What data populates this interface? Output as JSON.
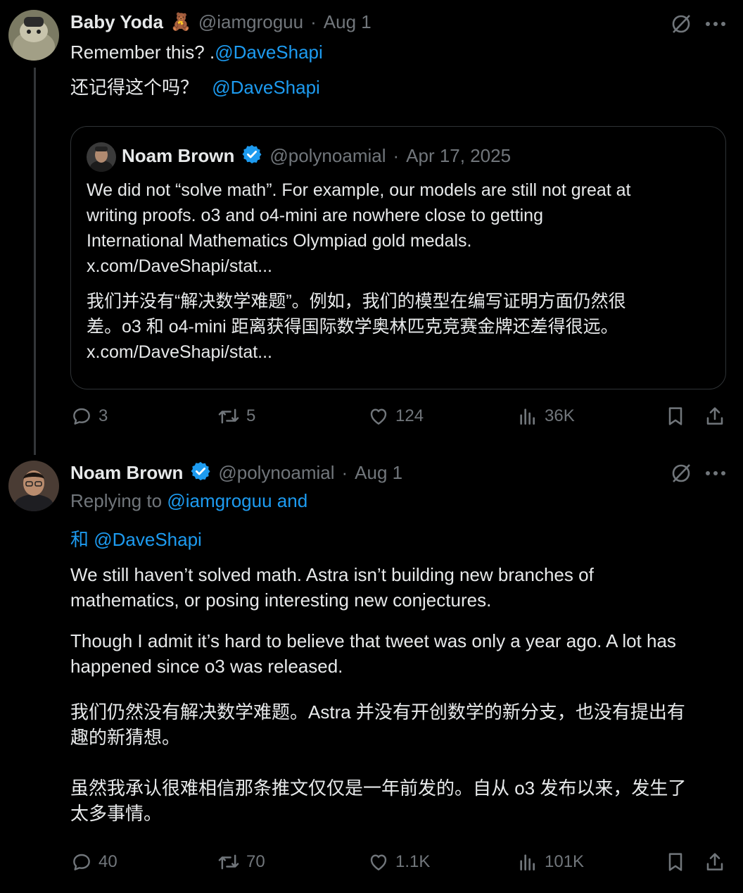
{
  "post1": {
    "display_name": "Baby Yoda",
    "emoji": "🧸",
    "handle": "@iamgroguu",
    "sep": "·",
    "date": "Aug 1",
    "line1_text": "Remember this? .",
    "line1_mention": "@DaveShapi",
    "line2_text": "还记得这个吗？",
    "line2_mention": "@DaveShapi",
    "quote": {
      "display_name": "Noam Brown",
      "handle": "@polynoamial",
      "sep": "·",
      "date": "Apr 17, 2025",
      "en_lines": [
        "We did not “solve math”. For example, our models are still not great at",
        "writing proofs. o3 and o4-mini are nowhere close to getting",
        "International Mathematics Olympiad gold medals.",
        "x.com/DaveShapi/stat..."
      ],
      "zh_lines": [
        "我们并没有“解决数学难题”。例如，我们的模型在编写证明方面仍然很",
        "差。o3 和 o4-mini 距离获得国际数学奥林匹克竞赛金牌还差得很远。",
        "x.com/DaveShapi/stat..."
      ]
    },
    "stats": {
      "replies": "3",
      "reposts": "5",
      "likes": "124",
      "views": "36K"
    }
  },
  "post2": {
    "display_name": "Noam Brown",
    "handle": "@polynoamial",
    "sep": "·",
    "date": "Aug 1",
    "replying_prefix": "Replying to ",
    "replying_mention": "@iamgroguu and",
    "and_line": "和 @DaveShapi",
    "en_p1": [
      "We still haven’t solved math. Astra isn’t building new branches of",
      "mathematics, or posing interesting new conjectures."
    ],
    "en_p2": [
      "Though I admit it’s hard to believe that tweet was only a year ago. A lot has",
      "happened since o3 was released."
    ],
    "zh_p1": [
      "我们仍然没有解决数学难题。Astra 并没有开创数学的新分支，也没有提出有",
      "趣的新猜想。"
    ],
    "zh_p2": [
      "虽然我承认很难相信那条推文仅仅是一年前发的。自从 o3 发布以来，发生了",
      "太多事情。"
    ],
    "stats": {
      "replies": "40",
      "reposts": "70",
      "likes": "1.1K",
      "views": "101K"
    }
  },
  "colors": {
    "background": "#000000",
    "text": "#e7e9ea",
    "muted": "#71767b",
    "link": "#1d9bf0",
    "border": "#2f3336"
  },
  "icons": [
    "translate-off-icon",
    "more-icon",
    "reply-icon",
    "repost-icon",
    "like-icon",
    "views-icon",
    "bookmark-icon",
    "share-icon",
    "verified-icon"
  ]
}
